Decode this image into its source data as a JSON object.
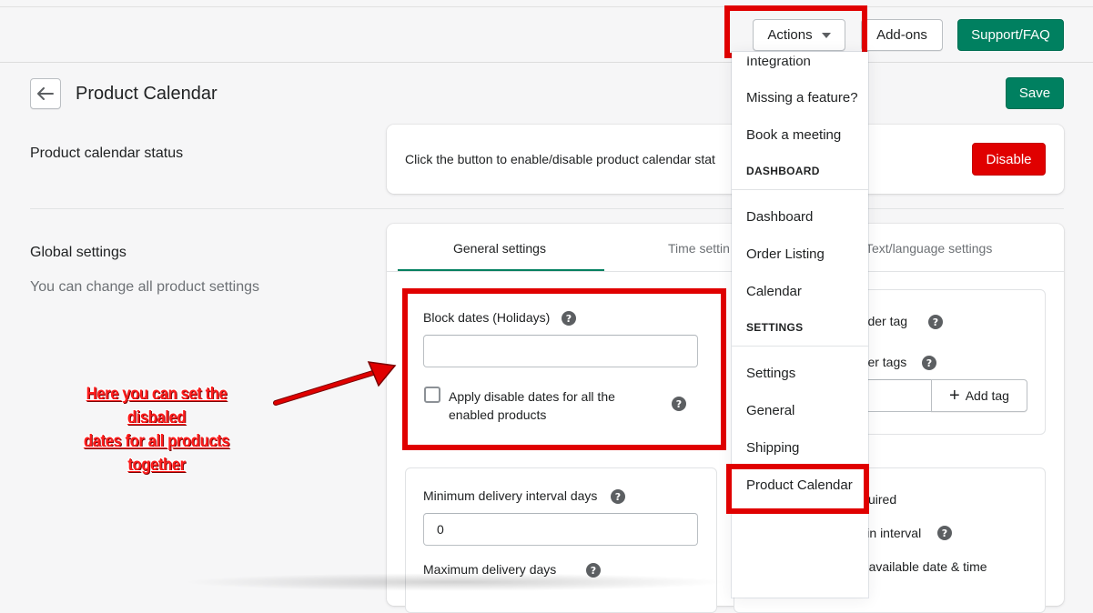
{
  "header": {
    "actions_label": "Actions",
    "addons_label": "Add-ons",
    "support_label": "Support/FAQ"
  },
  "page": {
    "title": "Product Calendar",
    "save_label": "Save"
  },
  "status_section": {
    "title": "Product calendar status",
    "description": "Click the button to enable/disable product calendar stat",
    "disable_label": "Disable"
  },
  "global_section": {
    "title": "Global settings",
    "subtitle": "You can change all product settings"
  },
  "tabs": [
    {
      "label": "General settings",
      "active": true
    },
    {
      "label": "Time settin",
      "active": false
    },
    {
      "label": "Text/language settings",
      "active": false
    }
  ],
  "block_dates": {
    "label": "Block dates (Holidays)",
    "input_value": "",
    "checkbox_label_line1": "Apply disable dates for all the",
    "checkbox_label_line2": "enabled products",
    "checked": false
  },
  "order_tag": {
    "label1": "order tag",
    "label2": "rder tags",
    "add_tag_label": "Add tag"
  },
  "delivery": {
    "min_label": "Minimum delivery interval days",
    "min_value": "0",
    "max_label": "Maximum delivery days"
  },
  "right_options": {
    "required_label": "uired",
    "include_holiday_label": "Include holiday in interval",
    "auto_select_label": "Auto select first available date & time"
  },
  "dropdown": {
    "items_top": [
      "Integration",
      "Missing a feature?",
      "Book a meeting"
    ],
    "dashboard_header": "DASHBOARD",
    "dashboard_items": [
      "Dashboard",
      "Order Listing",
      "Calendar"
    ],
    "settings_header": "SETTINGS",
    "settings_items": [
      "Settings",
      "General",
      "Shipping",
      "Product Calendar"
    ]
  },
  "annotation": {
    "line1": "Here you can set the disbaled",
    "line2": "dates for all products together"
  },
  "colors": {
    "primary_green": "#008060",
    "danger_red": "#e00000",
    "highlight_red": "#e00000"
  }
}
